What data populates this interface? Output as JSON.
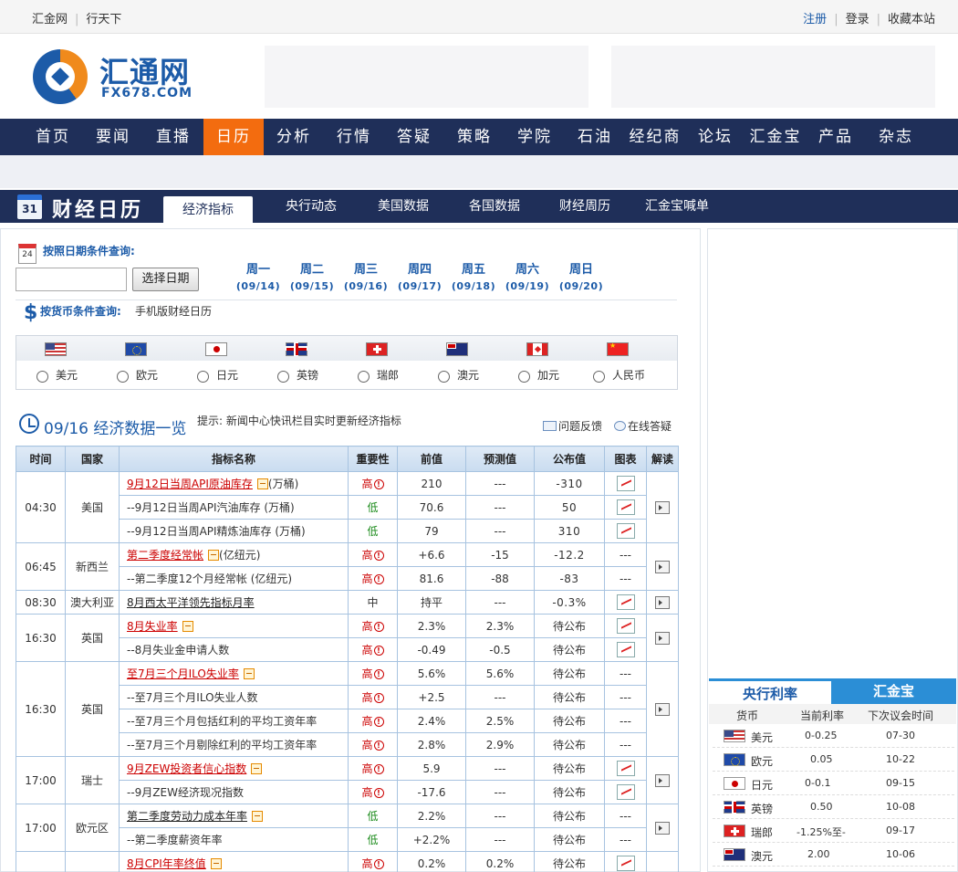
{
  "topbar": {
    "left_links": [
      "汇金网",
      "行天下"
    ],
    "register": "注册",
    "login": "登录",
    "bookmark": "收藏本站"
  },
  "logo": {
    "name": "汇通网",
    "url": "FX678.COM"
  },
  "nav": [
    "首页",
    "要闻",
    "直播",
    "日历",
    "分析",
    "行情",
    "答疑",
    "策略",
    "学院",
    "石油",
    "经纪商",
    "论坛",
    "汇金宝",
    "产品",
    "杂志"
  ],
  "nav_active": "日历",
  "calendar_bar": {
    "icon_text": "31",
    "title": "财经日历",
    "tabs": [
      "经济指标",
      "央行动态",
      "美国数据",
      "各国数据",
      "财经周历",
      "汇金宝喊单"
    ],
    "active_tab": "经济指标"
  },
  "query": {
    "date_icon": "24",
    "date_label": "按照日期条件查询:",
    "date_value": "",
    "date_button": "选择日期",
    "weekdays": [
      {
        "day": "周一",
        "date": "(09/14)"
      },
      {
        "day": "周二",
        "date": "(09/15)"
      },
      {
        "day": "周三",
        "date": "(09/16)"
      },
      {
        "day": "周四",
        "date": "(09/17)"
      },
      {
        "day": "周五",
        "date": "(09/18)"
      },
      {
        "day": "周六",
        "date": "(09/19)"
      },
      {
        "day": "周日",
        "date": "(09/20)"
      }
    ],
    "currency_label": "按货币条件查询:",
    "mobile_link": "手机版财经日历",
    "currencies": [
      "美元",
      "欧元",
      "日元",
      "英镑",
      "瑞郎",
      "澳元",
      "加元",
      "人民币"
    ]
  },
  "section": {
    "title": "09/16 经济数据一览",
    "hint": "提示: 新闻中心快讯栏目实时更新经济指标",
    "feedback": "问题反馈",
    "online_qa": "在线答疑"
  },
  "table": {
    "headers": [
      "时间",
      "国家",
      "指标名称",
      "重要性",
      "前值",
      "预测值",
      "公布值",
      "图表",
      "解读"
    ],
    "groups": [
      {
        "time": "04:30",
        "country": "美国",
        "rows": [
          {
            "name": "9月12日当周API原油库存",
            "unit": "(万桶)",
            "importance": "高",
            "prev": "210",
            "forecast": "---",
            "actual": "-310"
          },
          {
            "name": "--9月12日当周API汽油库存 (万桶)",
            "unit": "",
            "importance": "低",
            "prev": "70.6",
            "forecast": "---",
            "actual": "50"
          },
          {
            "name": "--9月12日当周API精炼油库存 (万桶)",
            "unit": "",
            "importance": "低",
            "prev": "79",
            "forecast": "---",
            "actual": "310"
          }
        ]
      },
      {
        "time": "06:45",
        "country": "新西兰",
        "rows": [
          {
            "name": "第二季度经常帐",
            "unit": "(亿纽元)",
            "importance": "高",
            "prev": "+6.6",
            "forecast": "-15",
            "actual": "-12.2"
          },
          {
            "name": "--第二季度12个月经常帐 (亿纽元)",
            "unit": "",
            "importance": "高",
            "prev": "81.6",
            "forecast": "-88",
            "actual": "-83"
          }
        ]
      },
      {
        "time": "08:30",
        "country": "澳大利亚",
        "rows": [
          {
            "name": "8月西太平洋领先指标月率",
            "unit": "",
            "importance": "中",
            "prev": "持平",
            "forecast": "---",
            "actual": "-0.3%"
          }
        ]
      },
      {
        "time": "16:30",
        "country": "英国",
        "rows": [
          {
            "name": "8月失业率",
            "unit": "",
            "importance": "高",
            "prev": "2.3%",
            "forecast": "2.3%",
            "actual": "待公布"
          },
          {
            "name": "--8月失业金申请人数",
            "unit": "",
            "importance": "高",
            "prev": "-0.49",
            "forecast": "-0.5",
            "actual": "待公布"
          }
        ]
      },
      {
        "time": "16:30",
        "country": "英国",
        "rows": [
          {
            "name": "至7月三个月ILO失业率",
            "unit": "",
            "importance": "高",
            "prev": "5.6%",
            "forecast": "5.6%",
            "actual": "待公布"
          },
          {
            "name": "--至7月三个月ILO失业人数",
            "unit": "",
            "importance": "高",
            "prev": "+2.5",
            "forecast": "---",
            "actual": "待公布"
          },
          {
            "name": "--至7月三个月包括红利的平均工资年率",
            "unit": "",
            "importance": "高",
            "prev": "2.4%",
            "forecast": "2.5%",
            "actual": "待公布"
          },
          {
            "name": "--至7月三个月剔除红利的平均工资年率",
            "unit": "",
            "importance": "高",
            "prev": "2.8%",
            "forecast": "2.9%",
            "actual": "待公布"
          }
        ]
      },
      {
        "time": "17:00",
        "country": "瑞士",
        "rows": [
          {
            "name": "9月ZEW投资者信心指数",
            "unit": "",
            "importance": "高",
            "prev": "5.9",
            "forecast": "---",
            "actual": "待公布"
          },
          {
            "name": "--9月ZEW经济现况指数",
            "unit": "",
            "importance": "高",
            "prev": "-17.6",
            "forecast": "---",
            "actual": "待公布"
          }
        ]
      },
      {
        "time": "17:00",
        "country": "欧元区",
        "rows": [
          {
            "name": "第二季度劳动力成本年率",
            "unit": "",
            "importance": "低",
            "prev": "2.2%",
            "forecast": "---",
            "actual": "待公布"
          },
          {
            "name": "--第二季度薪资年率",
            "unit": "",
            "importance": "低",
            "prev": "+2.2%",
            "forecast": "---",
            "actual": "待公布"
          }
        ]
      },
      {
        "time": "",
        "country": "",
        "rows": [
          {
            "name": "8月CPI年率终值",
            "unit": "",
            "importance": "高",
            "prev": "0.2%",
            "forecast": "0.2%",
            "actual": "待公布"
          }
        ]
      }
    ]
  },
  "rates": {
    "tabs": [
      "央行利率",
      "汇金宝"
    ],
    "headers": [
      "货币",
      "当前利率",
      "下次议会时间"
    ],
    "rows": [
      {
        "currency": "美元",
        "rate": "0-0.25",
        "next": "07-30"
      },
      {
        "currency": "欧元",
        "rate": "0.05",
        "next": "10-22"
      },
      {
        "currency": "日元",
        "rate": "0-0.1",
        "next": "09-15"
      },
      {
        "currency": "英镑",
        "rate": "0.50",
        "next": "10-08"
      },
      {
        "currency": "瑞郎",
        "rate": "-1.25%至-",
        "next": "09-17"
      },
      {
        "currency": "澳元",
        "rate": "2.00",
        "next": "10-06"
      }
    ]
  }
}
